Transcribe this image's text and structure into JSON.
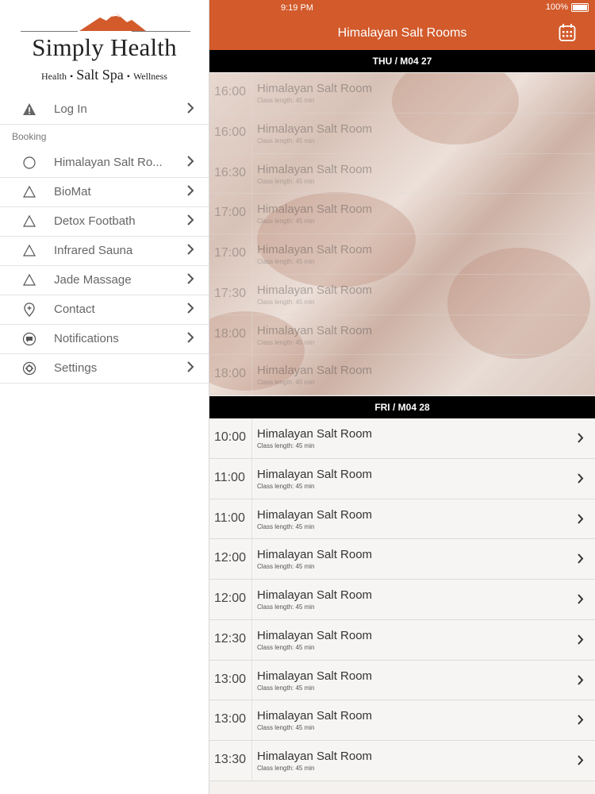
{
  "brand": {
    "name": "Simply Health",
    "tag_left": "Health",
    "tag_mid": "Salt Spa",
    "tag_right": "Wellness",
    "accent": "#d25a2b"
  },
  "sidebar": {
    "login": {
      "label": "Log In",
      "icon": "warning-icon"
    },
    "section": "Booking",
    "booking_items": [
      {
        "label": "Himalayan Salt Ro...",
        "icon": "circle-icon"
      },
      {
        "label": "BioMat",
        "icon": "triangle-icon"
      },
      {
        "label": "Detox Footbath",
        "icon": "triangle-icon"
      },
      {
        "label": "Infrared Sauna",
        "icon": "triangle-icon"
      },
      {
        "label": "Jade Massage",
        "icon": "triangle-icon"
      }
    ],
    "contact": {
      "label": "Contact",
      "icon": "map-pin-icon"
    },
    "notifications": {
      "label": "Notifications",
      "icon": "chat-bubble-icon"
    },
    "settings": {
      "label": "Settings",
      "icon": "gear-icon"
    }
  },
  "status": {
    "time": "9:19 PM",
    "battery": "100%"
  },
  "header": {
    "title": "Himalayan Salt Rooms"
  },
  "days": [
    {
      "label": "THU / M04 27",
      "past": true,
      "sessions": [
        {
          "time": "16:00",
          "name": "Himalayan Salt Room",
          "sub": "Class length: 45 min"
        },
        {
          "time": "16:00",
          "name": "Himalayan Salt Room",
          "sub": "Class length: 45 min"
        },
        {
          "time": "16:30",
          "name": "Himalayan Salt Room",
          "sub": "Class length: 45 min"
        },
        {
          "time": "17:00",
          "name": "Himalayan Salt Room",
          "sub": "Class length: 45 min"
        },
        {
          "time": "17:00",
          "name": "Himalayan Salt Room",
          "sub": "Class length: 45 min"
        },
        {
          "time": "17:30",
          "name": "Himalayan Salt Room",
          "sub": "Class length: 45 min"
        },
        {
          "time": "18:00",
          "name": "Himalayan Salt Room",
          "sub": "Class length: 45 min"
        },
        {
          "time": "18:00",
          "name": "Himalayan Salt Room",
          "sub": "Class length: 45 min"
        }
      ]
    },
    {
      "label": "FRI / M04 28",
      "past": false,
      "sessions": [
        {
          "time": "10:00",
          "name": "Himalayan Salt Room",
          "sub": "Class length: 45 min"
        },
        {
          "time": "11:00",
          "name": "Himalayan Salt Room",
          "sub": "Class length: 45 min"
        },
        {
          "time": "11:00",
          "name": "Himalayan Salt Room",
          "sub": "Class length: 45 min"
        },
        {
          "time": "12:00",
          "name": "Himalayan Salt Room",
          "sub": "Class length: 45 min"
        },
        {
          "time": "12:00",
          "name": "Himalayan Salt Room",
          "sub": "Class length: 45 min"
        },
        {
          "time": "12:30",
          "name": "Himalayan Salt Room",
          "sub": "Class length: 45 min"
        },
        {
          "time": "13:00",
          "name": "Himalayan Salt Room",
          "sub": "Class length: 45 min"
        },
        {
          "time": "13:00",
          "name": "Himalayan Salt Room",
          "sub": "Class length: 45 min"
        },
        {
          "time": "13:30",
          "name": "Himalayan Salt Room",
          "sub": "Class length: 45 min"
        }
      ]
    }
  ]
}
